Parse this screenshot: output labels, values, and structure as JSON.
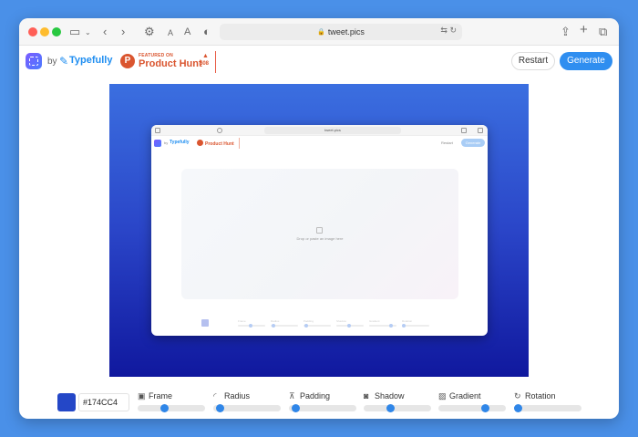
{
  "browser": {
    "url": "tweet.pics"
  },
  "header": {
    "by_label": "by",
    "brand_name": "Typefully",
    "product_hunt": {
      "featured": "FEATURED ON",
      "name": "Product Hunt",
      "count": "508"
    },
    "restart_label": "Restart",
    "generate_label": "Generate"
  },
  "preview": {
    "url": "tweet.pics",
    "brand_name": "Typefully",
    "product_hunt_name": "Product Hunt",
    "restart_label": "Restart",
    "generate_label": "Generate",
    "drop_text": "Drop or paste an image here"
  },
  "controls": {
    "color_hex": "#174CC4",
    "swatch_color": "#2447c7",
    "sliders": [
      {
        "icon": "frame-icon",
        "glyph": "▣",
        "label": "Frame",
        "value": 0.38
      },
      {
        "icon": "radius-icon",
        "glyph": "◜",
        "label": "Radius",
        "value": 0.05
      },
      {
        "icon": "padding-icon",
        "glyph": "⊼",
        "label": "Padding",
        "value": 0.05
      },
      {
        "icon": "shadow-icon",
        "glyph": "◙",
        "label": "Shadow",
        "value": 0.38
      },
      {
        "icon": "gradient-icon",
        "glyph": "▨",
        "label": "Gradient",
        "value": 0.72
      },
      {
        "icon": "rotation-icon",
        "glyph": "↻",
        "label": "Rotation",
        "value": 0.0
      }
    ]
  }
}
